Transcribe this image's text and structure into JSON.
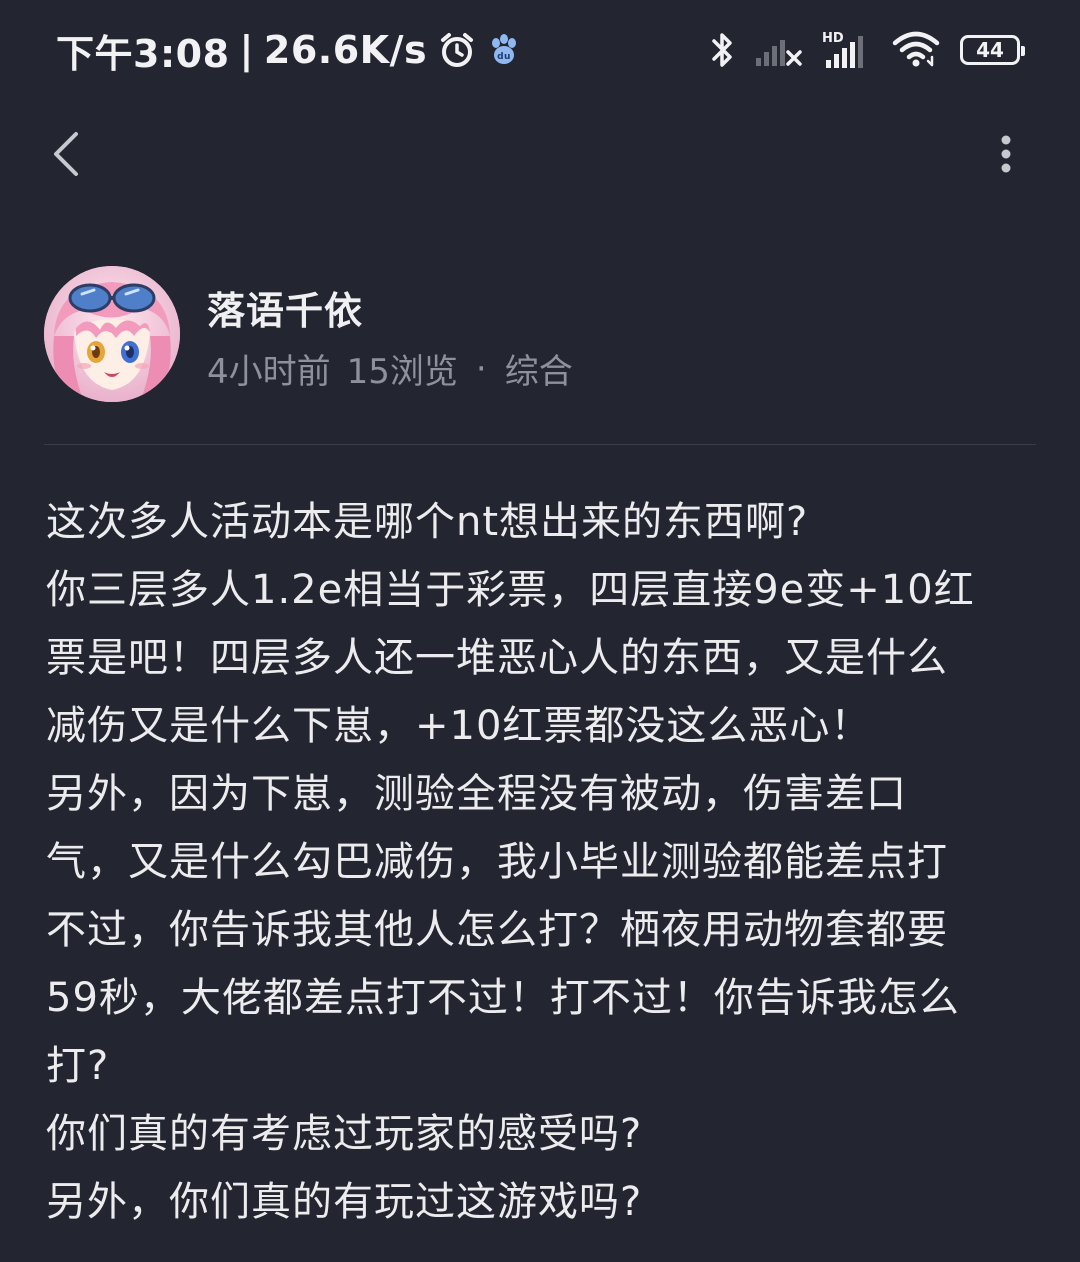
{
  "status_bar": {
    "time": "下午3:08",
    "separator": "|",
    "network_speed": "26.6K/s",
    "battery_level": "44",
    "hd_label": "HD",
    "icons": [
      "alarm-icon",
      "baidu-paw-icon",
      "bluetooth-icon",
      "signal-no-sim-icon",
      "signal-hd-icon",
      "wifi-icon",
      "battery-icon"
    ]
  },
  "nav": {
    "back_icon": "chevron-left-icon",
    "more_icon": "more-vertical-icon"
  },
  "author": {
    "name": "落语千依",
    "time_ago": "4小时前",
    "views": "15浏览",
    "dot": "·",
    "category": "综合"
  },
  "post": {
    "lines": [
      "这次多人活动本是哪个nt想出来的东西啊?",
      "你三层多人1.2e相当于彩票，四层直接9e变+10红",
      "票是吧！四层多人还一堆恶心人的东西，又是什么",
      "减伤又是什么下崽，+10红票都没这么恶心！",
      "另外，因为下崽，测验全程没有被动，伤害差口",
      "气，又是什么勾巴减伤，我小毕业测验都能差点打",
      "不过，你告诉我其他人怎么打？栖夜用动物套都要",
      "59秒，大佬都差点打不过！打不过！你告诉我怎么",
      "打?",
      "你们真的有考虑过玩家的感受吗?",
      "另外，你们真的有玩过这游戏吗?"
    ]
  },
  "colors": {
    "background": "#232530",
    "text_primary": "#ececee",
    "text_secondary": "#8e909a",
    "divider": "#3a3c48"
  }
}
